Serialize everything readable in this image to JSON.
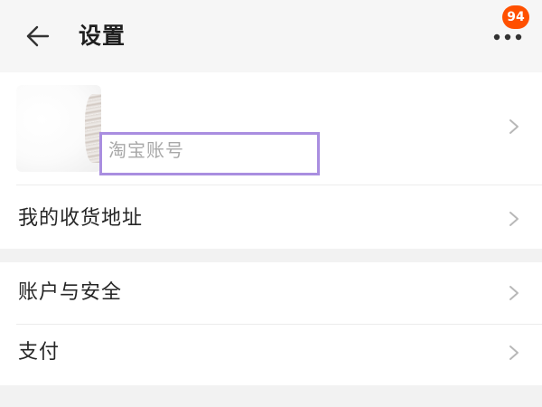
{
  "header": {
    "title": "设置",
    "back_icon": "arrow-left-icon",
    "more_icon": "more-dots-icon",
    "notification_count": "94",
    "badge_color": "#ff5000"
  },
  "account": {
    "avatar_icon": "user-avatar",
    "name": "淘宝账号",
    "highlight_color": "#a98ee0"
  },
  "menu_groups": [
    {
      "items": [
        {
          "label": "我的收货地址",
          "icon": "chevron-right-icon"
        }
      ]
    },
    {
      "items": [
        {
          "label": "账户与安全",
          "icon": "chevron-right-icon"
        },
        {
          "label": "支付",
          "icon": "chevron-right-icon"
        }
      ]
    }
  ]
}
